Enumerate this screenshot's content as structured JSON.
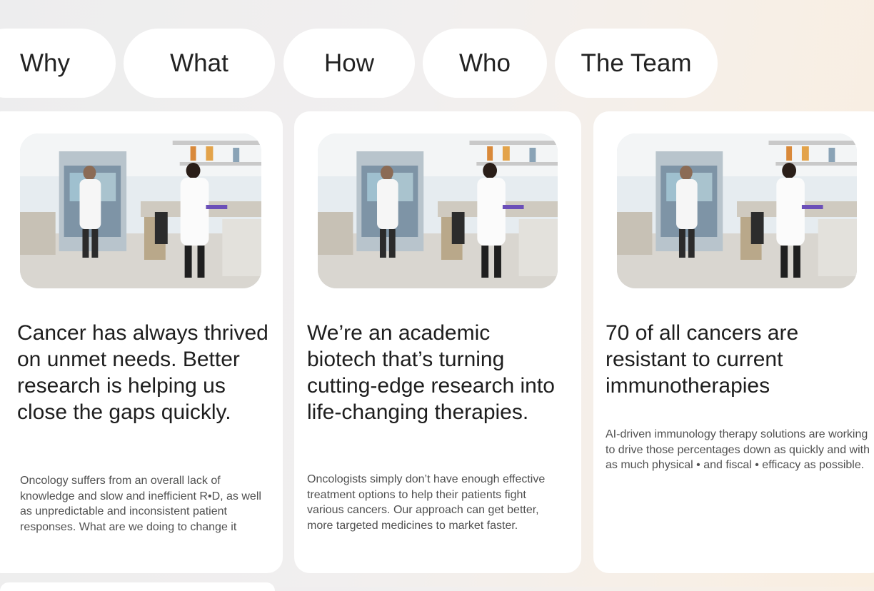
{
  "nav": {
    "items": [
      {
        "label": "Why"
      },
      {
        "label": "What"
      },
      {
        "label": "How"
      },
      {
        "label": "Who"
      },
      {
        "label": "The Team"
      }
    ]
  },
  "cards": [
    {
      "image_icon": "lab-photo",
      "title": "Cancer has always thrived on unmet needs. Better research is helping us close the gaps quickly.",
      "description": "Oncology suffers from an overall lack of knowledge and slow and inefficient R•D, as well as unpredictable and inconsistent patient responses. What are we doing to change it"
    },
    {
      "image_icon": "lab-photo",
      "title": "We’re an academic biotech that’s turning cutting-edge research into life-changing therapies.",
      "description": "Oncologists simply don’t have enough effective treatment options to help their patients fight various cancers. Our approach can get better, more targeted medicines to market faster."
    },
    {
      "image_icon": "lab-photo",
      "title": "70 of all cancers are resistant to current immunotherapies",
      "description": "AI-driven immunology therapy solutions are working to drive those percentages down as quickly and with as much physical • and fiscal • efficacy as possible."
    }
  ]
}
